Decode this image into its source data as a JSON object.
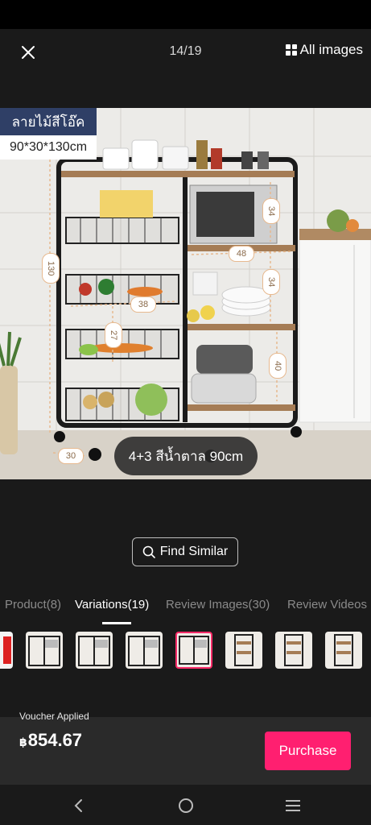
{
  "viewer": {
    "counter": "14/19",
    "all_images_label": "All images"
  },
  "image": {
    "tag_top": "ลายไม้สีโอ๊ค",
    "tag_size": "90*30*130cm",
    "dimension_labels": [
      "130",
      "34",
      "48",
      "34",
      "38",
      "27",
      "40",
      "30"
    ],
    "variant_caption": "4+3 สีน้ำตาล 90cm"
  },
  "actions": {
    "find_similar_label": "Find Similar"
  },
  "tabs": [
    {
      "label": "Product(8)",
      "active": false
    },
    {
      "label": "Variations(19)",
      "active": true
    },
    {
      "label": "Review Images(30)",
      "active": false
    },
    {
      "label": "Review Videos",
      "active": false
    }
  ],
  "footer": {
    "voucher_label": "Voucher Applied",
    "currency": "฿",
    "price": "854.67",
    "purchase_label": "Purchase"
  },
  "colors": {
    "accent": "#ff1f70",
    "selected_border": "#ff2a68",
    "image_tag_bg": "#2f3f66"
  }
}
